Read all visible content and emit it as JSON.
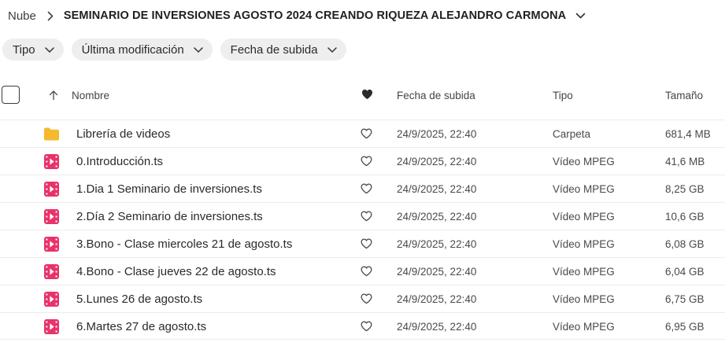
{
  "breadcrumb": {
    "root": "Nube",
    "current": "SEMINARIO DE INVERSIONES AGOSTO 2024 CREANDO RIQUEZA ALEJANDRO CARMONA"
  },
  "filters": [
    {
      "label": "Tipo"
    },
    {
      "label": "Última modificación"
    },
    {
      "label": "Fecha de subida"
    }
  ],
  "columns": {
    "name": "Nombre",
    "date": "Fecha de subida",
    "type": "Tipo",
    "size": "Tamaño"
  },
  "colors": {
    "folder": "#f5b92e",
    "video": "#e8336a",
    "heart": "#2b2b2b"
  },
  "files": [
    {
      "icon": "folder-icon",
      "name": "Librería de videos",
      "date": "24/9/2025, 22:40",
      "type": "Carpeta",
      "size": "681,4 MB"
    },
    {
      "icon": "video-file-icon",
      "name": "0.Introducción.ts",
      "date": "24/9/2025, 22:40",
      "type": "Vídeo MPEG",
      "size": "41,6 MB"
    },
    {
      "icon": "video-file-icon",
      "name": "1.Dia 1 Seminario de inversiones.ts",
      "date": "24/9/2025, 22:40",
      "type": "Vídeo MPEG",
      "size": "8,25 GB"
    },
    {
      "icon": "video-file-icon",
      "name": "2.Día 2 Seminario de inversiones.ts",
      "date": "24/9/2025, 22:40",
      "type": "Vídeo MPEG",
      "size": "10,6 GB"
    },
    {
      "icon": "video-file-icon",
      "name": "3.Bono - Clase miercoles 21 de agosto.ts",
      "date": "24/9/2025, 22:40",
      "type": "Vídeo MPEG",
      "size": "6,08 GB"
    },
    {
      "icon": "video-file-icon",
      "name": "4.Bono - Clase jueves 22 de agosto.ts",
      "date": "24/9/2025, 22:40",
      "type": "Vídeo MPEG",
      "size": "6,04 GB"
    },
    {
      "icon": "video-file-icon",
      "name": "5.Lunes 26 de agosto.ts",
      "date": "24/9/2025, 22:40",
      "type": "Vídeo MPEG",
      "size": "6,75 GB"
    },
    {
      "icon": "video-file-icon",
      "name": "6.Martes 27 de agosto.ts",
      "date": "24/9/2025, 22:40",
      "type": "Vídeo MPEG",
      "size": "6,95 GB"
    }
  ]
}
